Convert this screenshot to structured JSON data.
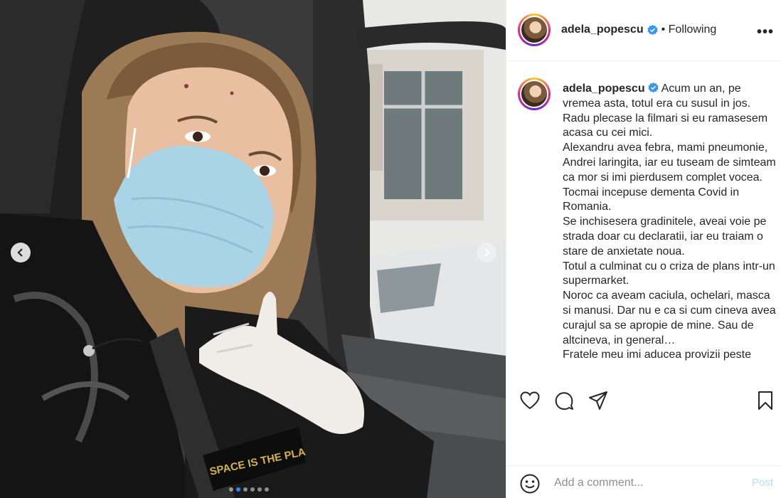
{
  "post": {
    "username": "adela_popescu",
    "follow_status": "• Following",
    "more_label": "•••",
    "caption": "Acum un an, pe vremea asta, totul era cu susul in jos.\nRadu plecase la filmari si eu ramasesem acasa cu cei mici.\nAlexandru avea febra, mami pneumonie, Andrei laringita, iar eu tuseam de simteam ca mor si imi pierdusem complet vocea.\nTocmai incepuse dementa Covid in Romania.\nSe inchisesera gradinitele, aveai voie pe strada doar cu declaratii, iar eu traiam o stare de anxietate noua.\nTotul a culminat cu o criza de plans intr-un supermarket.\nNoroc ca aveam caciula, ochelari, masca si manusi. Dar nu e ca si cum cineva avea curajul sa se apropie de mine. Sau de altcineva, in general…\nFratele meu imi aducea provizii peste"
  },
  "media": {
    "overlay_text": "SPACE IS THE PLA",
    "carousel": {
      "count": 6,
      "active": 2
    }
  },
  "comment": {
    "placeholder": "Add a comment...",
    "post_label": "Post"
  },
  "colors": {
    "verified": "#3897f0",
    "post_disabled": "#b2dffc",
    "active_dot": "#2d86ff"
  },
  "icons": [
    "chevron-left-icon",
    "chevron-right-icon",
    "verified-badge-icon",
    "heart-icon",
    "comment-icon",
    "share-icon",
    "bookmark-icon",
    "emoji-icon"
  ]
}
